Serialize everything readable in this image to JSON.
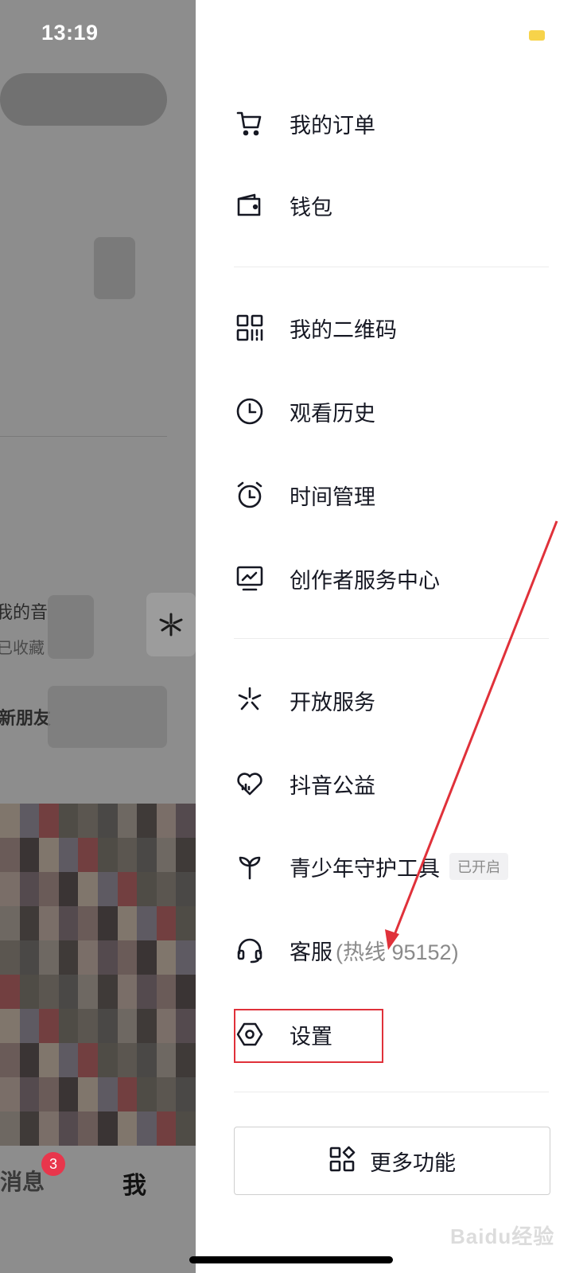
{
  "status_bar": {
    "time": "13:19"
  },
  "background_page": {
    "music_title_fragment": "我的音",
    "music_sub_fragment": "已收藏",
    "friends_fragment": "新朋友",
    "tabs": {
      "messages": "消息",
      "messages_badge": "3",
      "me": "我"
    }
  },
  "drawer": {
    "menu_groups": [
      [
        {
          "name": "my-orders",
          "icon": "cart-icon",
          "label": "我的订单"
        },
        {
          "name": "wallet",
          "icon": "wallet-icon",
          "label": "钱包"
        }
      ],
      [
        {
          "name": "my-qrcode",
          "icon": "qrcode-icon",
          "label": "我的二维码"
        },
        {
          "name": "watch-history",
          "icon": "clock-icon",
          "label": "观看历史"
        },
        {
          "name": "time-management",
          "icon": "alarm-icon",
          "label": "时间管理"
        },
        {
          "name": "creator-center",
          "icon": "monitor-chart-icon",
          "label": "创作者服务中心"
        }
      ],
      [
        {
          "name": "open-services",
          "icon": "asterisk-icon",
          "label": "开放服务"
        },
        {
          "name": "douyin-charity",
          "icon": "heart-icon",
          "label": "抖音公益"
        },
        {
          "name": "teen-protection",
          "icon": "sprout-icon",
          "label": "青少年守护工具",
          "tag": "已开启"
        },
        {
          "name": "customer-service",
          "icon": "headset-icon",
          "label": "客服",
          "hint": "(热线 95152)"
        },
        {
          "name": "settings",
          "icon": "settings-icon",
          "label": "设置"
        }
      ]
    ],
    "more_button": {
      "label": "更多功能",
      "icon": "grid-shapes-icon"
    },
    "watermark": "Baidu经验",
    "annotation_color": "#e0313a"
  }
}
